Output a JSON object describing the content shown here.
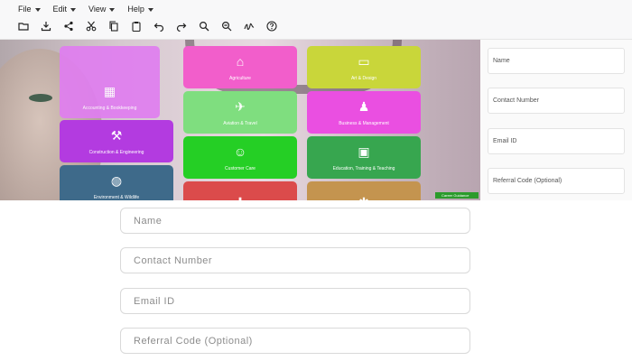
{
  "menu": [
    "File",
    "Edit",
    "View",
    "Help"
  ],
  "toolbar_icons": [
    "folder-open-icon",
    "download-icon",
    "share-icon",
    "cut-icon",
    "copy-icon",
    "paste-icon",
    "undo-icon",
    "redo-icon",
    "zoom-in-icon",
    "zoom-out-icon",
    "signature-icon",
    "help-icon"
  ],
  "hero": {
    "tiles": [
      {
        "label": "Accounting & Bookkeeping",
        "color": "#e07ef0"
      },
      {
        "label": "Agriculture",
        "color": "#f25ecb"
      },
      {
        "label": "Art & Design",
        "color": "#c9d63a"
      },
      {
        "label": "Aviation & Travel",
        "color": "#7fde7f"
      },
      {
        "label": "Business & Management",
        "color": "#ea4fe1"
      },
      {
        "label": "Construction & Engineering",
        "color": "#b33be0"
      },
      {
        "label": "Customer Care",
        "color": "#25cf25"
      },
      {
        "label": "Education, Training & Teaching",
        "color": "#37a64f"
      },
      {
        "label": "Environment & Wildlife",
        "color": "#3e6a8a"
      },
      {
        "label": "",
        "color": "#db4b4b"
      },
      {
        "label": "",
        "color": "#c4944f"
      }
    ],
    "badge": "Career Guidance"
  },
  "side_fields": [
    "Name",
    "Contact Number",
    "Email ID",
    "Referral Code (Optional)"
  ],
  "form": {
    "name_placeholder": "Name",
    "contact_placeholder": "Contact Number",
    "email_placeholder": "Email ID",
    "referral_placeholder": "Referral Code (Optional)"
  }
}
